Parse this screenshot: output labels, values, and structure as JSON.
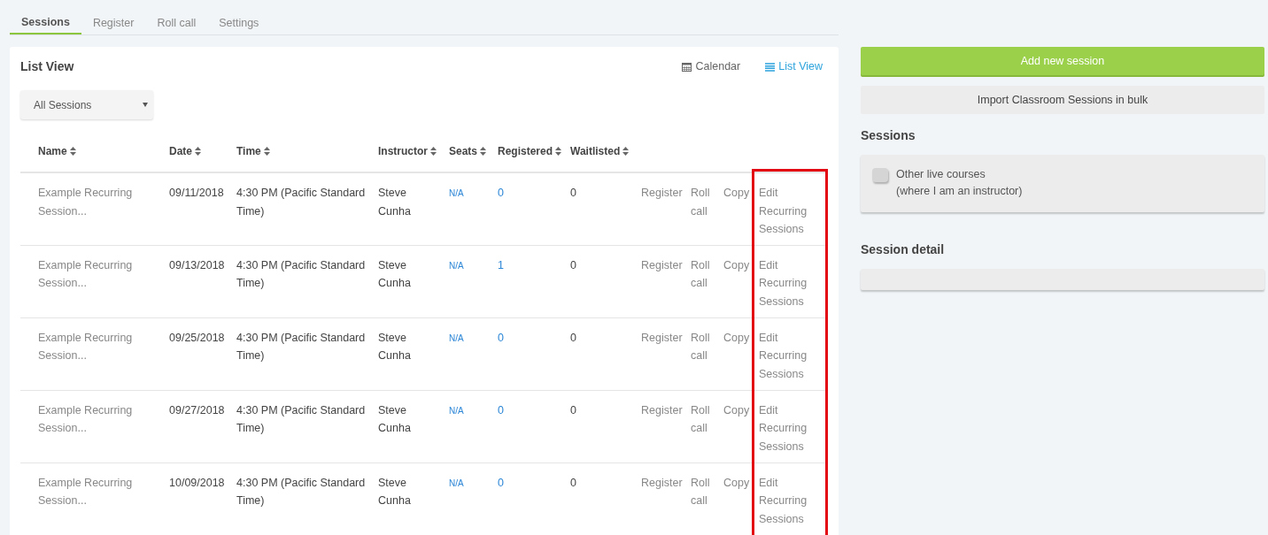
{
  "tabs": [
    {
      "label": "Sessions",
      "selected": true
    },
    {
      "label": "Register",
      "selected": false
    },
    {
      "label": "Roll call",
      "selected": false
    },
    {
      "label": "Settings",
      "selected": false
    }
  ],
  "list_panel": {
    "title": "List View",
    "views": [
      {
        "label": "Calendar",
        "selected": false
      },
      {
        "label": "List View",
        "selected": true
      }
    ],
    "filter": {
      "value": "All Sessions"
    },
    "columns": [
      "Name",
      "Date",
      "Time",
      "Instructor",
      "Seats",
      "Registered",
      "Waitlisted"
    ],
    "highlight_actions": true,
    "rows": [
      {
        "name": "Example Recurring Session...",
        "date": "09/11/2018",
        "time": "4:30 PM (Pacific Standard Time)",
        "instructor": "Steve Cunha",
        "seats": "N/A",
        "registered": "0",
        "waitlisted": "0",
        "actions": [
          "Register",
          "Roll call",
          "Copy",
          "Edit Recurring Sessions"
        ]
      },
      {
        "name": "Example Recurring Session...",
        "date": "09/13/2018",
        "time": "4:30 PM (Pacific Standard Time)",
        "instructor": "Steve Cunha",
        "seats": "N/A",
        "registered": "1",
        "waitlisted": "0",
        "actions": [
          "Register",
          "Roll call",
          "Copy",
          "Edit Recurring Sessions"
        ]
      },
      {
        "name": "Example Recurring Session...",
        "date": "09/25/2018",
        "time": "4:30 PM (Pacific Standard Time)",
        "instructor": "Steve Cunha",
        "seats": "N/A",
        "registered": "0",
        "waitlisted": "0",
        "actions": [
          "Register",
          "Roll call",
          "Copy",
          "Edit Recurring Sessions"
        ]
      },
      {
        "name": "Example Recurring Session...",
        "date": "09/27/2018",
        "time": "4:30 PM (Pacific Standard Time)",
        "instructor": "Steve Cunha",
        "seats": "N/A",
        "registered": "0",
        "waitlisted": "0",
        "actions": [
          "Register",
          "Roll call",
          "Copy",
          "Edit Recurring Sessions"
        ]
      },
      {
        "name": "Example Recurring Session...",
        "date": "10/09/2018",
        "time": "4:30 PM (Pacific Standard Time)",
        "instructor": "Steve Cunha",
        "seats": "N/A",
        "registered": "0",
        "waitlisted": "0",
        "actions": [
          "Register",
          "Roll call",
          "Copy",
          "Edit Recurring Sessions"
        ]
      }
    ]
  },
  "side": {
    "add_button": "Add new session",
    "import_button": "Import Classroom Sessions in bulk",
    "sessions_title": "Sessions",
    "toggle": {
      "label": "Other live courses",
      "sublabel": "(where I am an instructor)",
      "on": false
    },
    "detail_title": "Session detail"
  }
}
